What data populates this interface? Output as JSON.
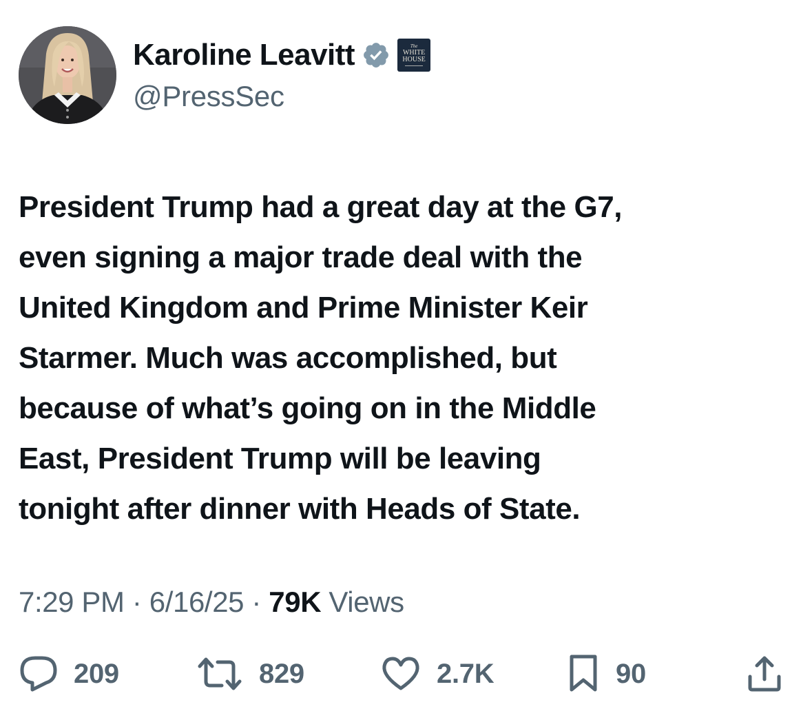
{
  "author": {
    "display_name": "Karoline Leavitt",
    "handle": "@PressSec",
    "verified_icon": "verified-badge-icon",
    "affiliation_badge": {
      "line1": "The",
      "line2": "WHITE",
      "line3": "HOUSE"
    }
  },
  "tweet": {
    "text": "President Trump had a great day at the G7,\neven signing a major trade deal with the\nUnited Kingdom and Prime Minister Keir\nStarmer. Much was accomplished, but\nbecause of what’s going on in the Middle\nEast, President Trump will be leaving\ntonight after dinner with Heads of State."
  },
  "meta": {
    "time": "7:29 PM",
    "separator": "·",
    "date": "6/16/25",
    "views_count": "79K",
    "views_label": "Views"
  },
  "actions": {
    "replies": "209",
    "retweets": "829",
    "likes": "2.7K",
    "bookmarks": "90"
  },
  "colors": {
    "text": "#0f1419",
    "secondary": "#536471",
    "verified": "#829aab",
    "affiliate_bg": "#1b2a3d"
  }
}
